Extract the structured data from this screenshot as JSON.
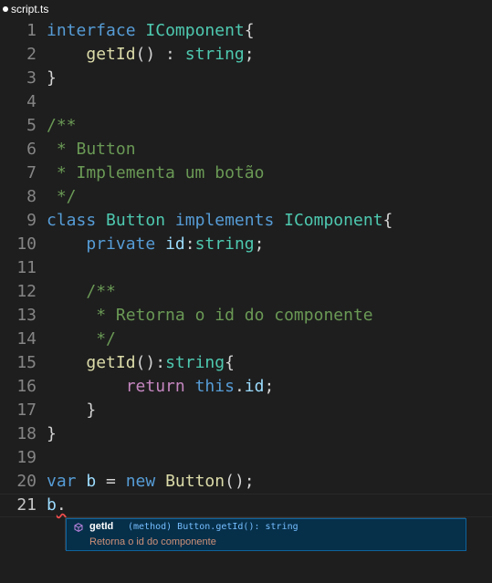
{
  "tab": {
    "filename": "script.ts",
    "unsaved_indicator": "●"
  },
  "editor": {
    "lines": [
      {
        "n": "1",
        "tokens": [
          [
            "kw",
            "interface"
          ],
          [
            "plain",
            " "
          ],
          [
            "type",
            "IComponent"
          ],
          [
            "plain",
            "{"
          ]
        ]
      },
      {
        "n": "2",
        "tokens": [
          [
            "plain",
            "    "
          ],
          [
            "fn",
            "getId"
          ],
          [
            "plain",
            "() : "
          ],
          [
            "type",
            "string"
          ],
          [
            "plain",
            ";"
          ]
        ]
      },
      {
        "n": "3",
        "tokens": [
          [
            "plain",
            "}"
          ]
        ]
      },
      {
        "n": "4",
        "tokens": []
      },
      {
        "n": "5",
        "tokens": [
          [
            "cm",
            "/**"
          ]
        ]
      },
      {
        "n": "6",
        "tokens": [
          [
            "cm",
            " * Button"
          ]
        ]
      },
      {
        "n": "7",
        "tokens": [
          [
            "cm",
            " * Implementa um botão"
          ]
        ]
      },
      {
        "n": "8",
        "tokens": [
          [
            "cm",
            " */"
          ]
        ]
      },
      {
        "n": "9",
        "tokens": [
          [
            "kw",
            "class"
          ],
          [
            "plain",
            " "
          ],
          [
            "type",
            "Button"
          ],
          [
            "plain",
            " "
          ],
          [
            "kw",
            "implements"
          ],
          [
            "plain",
            " "
          ],
          [
            "type",
            "IComponent"
          ],
          [
            "plain",
            "{"
          ]
        ]
      },
      {
        "n": "10",
        "tokens": [
          [
            "plain",
            "    "
          ],
          [
            "kw",
            "private"
          ],
          [
            "plain",
            " "
          ],
          [
            "var",
            "id"
          ],
          [
            "plain",
            ":"
          ],
          [
            "type",
            "string"
          ],
          [
            "plain",
            ";"
          ]
        ]
      },
      {
        "n": "11",
        "tokens": []
      },
      {
        "n": "12",
        "tokens": [
          [
            "plain",
            "    "
          ],
          [
            "cm",
            "/**"
          ]
        ]
      },
      {
        "n": "13",
        "tokens": [
          [
            "plain",
            "    "
          ],
          [
            "cm",
            " * Retorna o id do componente"
          ]
        ]
      },
      {
        "n": "14",
        "tokens": [
          [
            "plain",
            "    "
          ],
          [
            "cm",
            " */"
          ]
        ]
      },
      {
        "n": "15",
        "tokens": [
          [
            "plain",
            "    "
          ],
          [
            "fn",
            "getId"
          ],
          [
            "plain",
            "():"
          ],
          [
            "type",
            "string"
          ],
          [
            "plain",
            "{"
          ]
        ]
      },
      {
        "n": "16",
        "tokens": [
          [
            "plain",
            "        "
          ],
          [
            "kw2",
            "return"
          ],
          [
            "plain",
            " "
          ],
          [
            "kw",
            "this"
          ],
          [
            "plain",
            "."
          ],
          [
            "var",
            "id"
          ],
          [
            "plain",
            ";"
          ]
        ]
      },
      {
        "n": "17",
        "tokens": [
          [
            "plain",
            "    }"
          ]
        ]
      },
      {
        "n": "18",
        "tokens": [
          [
            "plain",
            "}"
          ]
        ]
      },
      {
        "n": "19",
        "tokens": []
      },
      {
        "n": "20",
        "tokens": [
          [
            "kw",
            "var"
          ],
          [
            "plain",
            " "
          ],
          [
            "var",
            "b"
          ],
          [
            "plain",
            " = "
          ],
          [
            "kw",
            "new"
          ],
          [
            "plain",
            " "
          ],
          [
            "fn",
            "Button"
          ],
          [
            "plain",
            "();"
          ]
        ]
      },
      {
        "n": "21",
        "tokens": [
          [
            "var",
            "b"
          ],
          [
            "plain",
            "."
          ]
        ],
        "current": true,
        "squiggle_token": 1
      }
    ]
  },
  "suggest": {
    "icon": "method-cube-icon",
    "name": "getId",
    "detail": "(method) Button.getId(): string",
    "doc": "Retorna o id do componente",
    "colors": {
      "selected_bg": "#062f4a",
      "detail": "#75beff",
      "doc": "#ce9178"
    }
  },
  "colors": {
    "background": "#1e1e1e",
    "keyword": "#569cd6",
    "control_keyword": "#c586c0",
    "type": "#4ec9b0",
    "function": "#dcdcaa",
    "variable": "#9cdcfe",
    "comment": "#6a9955",
    "text": "#d4d4d4",
    "line_number": "#858585"
  }
}
